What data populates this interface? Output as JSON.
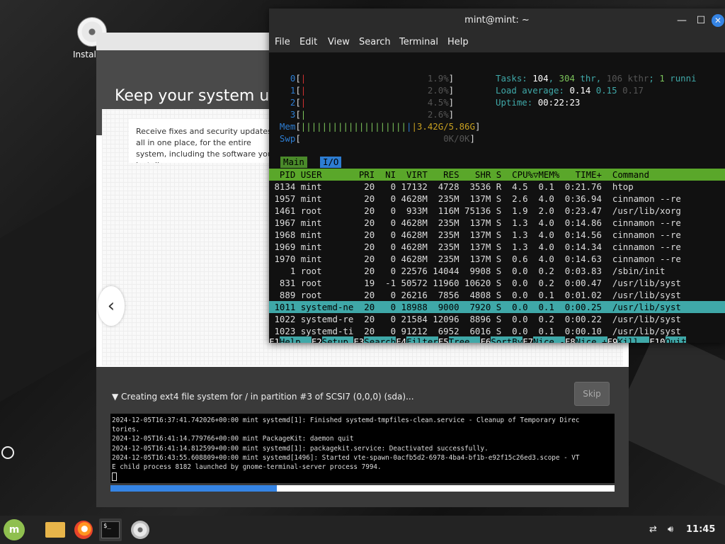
{
  "desktop": {
    "icon_label": "Instal"
  },
  "installer": {
    "title": "Keep your system up",
    "card_text": "Receive fixes and security updates all in one place, for the entire system, including the software you install.",
    "progress_label": "Creating ext4 file system for / in partition #3 of SCSI7 (0,0,0) (sda)...",
    "skip_label": "Skip",
    "progress": 0.33,
    "log_lines": [
      "2024-12-05T16:37:41.742026+00:00 mint systemd[1]: Finished systemd-tmpfiles-clean.service - Cleanup of Temporary Direc",
      "tories.",
      "2024-12-05T16:41:14.779766+00:00 mint PackageKit: daemon quit",
      "2024-12-05T16:41:14.812599+00:00 mint systemd[1]: packagekit.service: Deactivated successfully.",
      "2024-12-05T16:43:55.608809+00:00 mint systemd[1496]: Started vte-spawn-0acfb5d2-6978-4ba4-bf1b-e92f15c26ed3.scope - VT",
      "E child process 8182 launched by gnome-terminal-server process 7994."
    ]
  },
  "terminal": {
    "title": "mint@mint: ~",
    "menu": [
      "File",
      "Edit",
      "View",
      "Search",
      "Terminal",
      "Help"
    ],
    "cpu_pct": [
      "1.9%",
      "2.0%",
      "4.5%",
      "2.6%"
    ],
    "mem": "3.42G/5.86G",
    "swp": "0K/0K",
    "tasks": "104",
    "thr": "304",
    "kthr": "106",
    "running": "1",
    "load1": "0.14",
    "load5": "0.15",
    "load15": "0.17",
    "uptime": "00:22:23",
    "tab_main": "Main",
    "tab_io": "I/O",
    "headers": "  PID USER       PRI  NI  VIRT   RES   SHR S  CPU%▽MEM%   TIME+  Command",
    "processes": [
      {
        "pid": "8134",
        "user": "mint",
        "pri": "20",
        "ni": "0",
        "virt": "17132",
        "res": "4728",
        "shr": "3536",
        "s": "R",
        "cpu": "4.5",
        "mem": "0.1",
        "time": "0:21.76",
        "cmd": "htop"
      },
      {
        "pid": "1957",
        "user": "mint",
        "pri": "20",
        "ni": "0",
        "virt": "4628M",
        "res": "235M",
        "shr": "137M",
        "s": "S",
        "cpu": "2.6",
        "mem": "4.0",
        "time": "0:36.94",
        "cmd": "cinnamon --re"
      },
      {
        "pid": "1461",
        "user": "root",
        "pri": "20",
        "ni": "0",
        "virt": "933M",
        "res": "116M",
        "shr": "75136",
        "s": "S",
        "cpu": "1.9",
        "mem": "2.0",
        "time": "0:23.47",
        "cmd": "/usr/lib/xorg"
      },
      {
        "pid": "1967",
        "user": "mint",
        "pri": "20",
        "ni": "0",
        "virt": "4628M",
        "res": "235M",
        "shr": "137M",
        "s": "S",
        "cpu": "1.3",
        "mem": "4.0",
        "time": "0:14.86",
        "cmd": "cinnamon --re"
      },
      {
        "pid": "1968",
        "user": "mint",
        "pri": "20",
        "ni": "0",
        "virt": "4628M",
        "res": "235M",
        "shr": "137M",
        "s": "S",
        "cpu": "1.3",
        "mem": "4.0",
        "time": "0:14.56",
        "cmd": "cinnamon --re"
      },
      {
        "pid": "1969",
        "user": "mint",
        "pri": "20",
        "ni": "0",
        "virt": "4628M",
        "res": "235M",
        "shr": "137M",
        "s": "S",
        "cpu": "1.3",
        "mem": "4.0",
        "time": "0:14.34",
        "cmd": "cinnamon --re"
      },
      {
        "pid": "1970",
        "user": "mint",
        "pri": "20",
        "ni": "0",
        "virt": "4628M",
        "res": "235M",
        "shr": "137M",
        "s": "S",
        "cpu": "0.6",
        "mem": "4.0",
        "time": "0:14.63",
        "cmd": "cinnamon --re"
      },
      {
        "pid": "1",
        "user": "root",
        "pri": "20",
        "ni": "0",
        "virt": "22576",
        "res": "14044",
        "shr": "9908",
        "s": "S",
        "cpu": "0.0",
        "mem": "0.2",
        "time": "0:03.83",
        "cmd": "/sbin/init"
      },
      {
        "pid": "831",
        "user": "root",
        "pri": "19",
        "ni": "-1",
        "virt": "50572",
        "res": "11960",
        "shr": "10620",
        "s": "S",
        "cpu": "0.0",
        "mem": "0.2",
        "time": "0:00.47",
        "cmd": "/usr/lib/syst"
      },
      {
        "pid": "889",
        "user": "root",
        "pri": "20",
        "ni": "0",
        "virt": "26216",
        "res": "7856",
        "shr": "4808",
        "s": "S",
        "cpu": "0.0",
        "mem": "0.1",
        "time": "0:01.02",
        "cmd": "/usr/lib/syst"
      },
      {
        "pid": "1011",
        "user": "systemd-ne",
        "pri": "20",
        "ni": "0",
        "virt": "18988",
        "res": "9000",
        "shr": "7920",
        "s": "S",
        "cpu": "0.0",
        "mem": "0.1",
        "time": "0:00.25",
        "cmd": "/usr/lib/syst"
      },
      {
        "pid": "1022",
        "user": "systemd-re",
        "pri": "20",
        "ni": "0",
        "virt": "21584",
        "res": "12096",
        "shr": "8896",
        "s": "S",
        "cpu": "0.0",
        "mem": "0.2",
        "time": "0:00.22",
        "cmd": "/usr/lib/syst"
      },
      {
        "pid": "1023",
        "user": "systemd-ti",
        "pri": "20",
        "ni": "0",
        "virt": "91212",
        "res": "6952",
        "shr": "6016",
        "s": "S",
        "cpu": "0.0",
        "mem": "0.1",
        "time": "0:00.10",
        "cmd": "/usr/lib/syst"
      }
    ],
    "fkeys": [
      {
        "k": "F1",
        "v": "Help  "
      },
      {
        "k": "F2",
        "v": "Setup "
      },
      {
        "k": "F3",
        "v": "Search"
      },
      {
        "k": "F4",
        "v": "Filter"
      },
      {
        "k": "F5",
        "v": "Tree  "
      },
      {
        "k": "F6",
        "v": "SortBy"
      },
      {
        "k": "F7",
        "v": "Nice -"
      },
      {
        "k": "F8",
        "v": "Nice +"
      },
      {
        "k": "F9",
        "v": "Kill  "
      },
      {
        "k": "F10",
        "v": "Quit"
      }
    ]
  },
  "taskbar": {
    "clock": "11:45"
  }
}
